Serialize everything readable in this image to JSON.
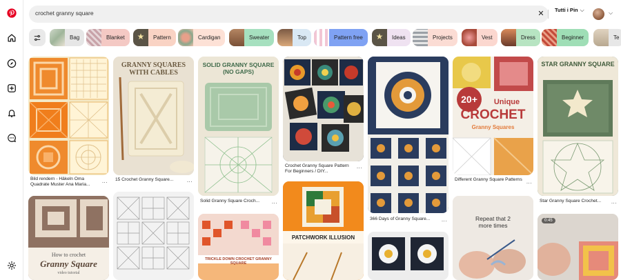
{
  "search": {
    "query": "crochet granny square",
    "clear_icon": "close-icon"
  },
  "scope": {
    "label": "Tutti i Pin"
  },
  "rail": {
    "icons": [
      "pinterest-logo",
      "home-icon",
      "compass-icon",
      "create-icon",
      "bell-icon",
      "messages-icon",
      "settings-icon"
    ]
  },
  "colors": {
    "brand": "#e60023",
    "chip_selected": "#7fa2f3"
  },
  "chips": [
    {
      "label": "Bag",
      "bg": "#e6e6e6"
    },
    {
      "label": "Blanket",
      "bg": "#f4c9c4"
    },
    {
      "label": "Pattern",
      "bg": "#f9d3c4"
    },
    {
      "label": "Cardigan",
      "bg": "#fde1d6"
    },
    {
      "label": "Sweater",
      "bg": "#a6e0bf"
    },
    {
      "label": "Top",
      "bg": "#d9e8f4"
    },
    {
      "label": "Pattern free",
      "bg": "#7fa2f3"
    },
    {
      "label": "Ideas",
      "bg": "#efe2f1"
    },
    {
      "label": "Projects",
      "bg": "#fbdcd4"
    },
    {
      "label": "Vest",
      "bg": "#fbd7cf"
    },
    {
      "label": "Dress",
      "bg": "#b7e4c2"
    },
    {
      "label": "Beginner",
      "bg": "#9fdeb6"
    },
    {
      "label": "Te",
      "bg": "#e7e7e7"
    }
  ],
  "pins": [
    {
      "caption": "Bild rendern - Häkeln Oma Quadrate Muster Ana Maria..."
    },
    {
      "caption": "",
      "overlay": "How to crochet",
      "overlay2": "Granny Square",
      "overlay3": "video tutorial"
    },
    {
      "caption": "15 Crochet Granny Square...",
      "overlay": "GRANNY SQUARES WITH CABLES"
    },
    {
      "caption": ""
    },
    {
      "caption": "Solid Granny Square Croch...",
      "overlay": "SOLID GRANNY SQUARE (NO GAPS)"
    },
    {
      "caption": "",
      "overlay": "TRICKLE DOWN CROCHET GRANNY SQUARE"
    },
    {
      "caption": "Crochet Granny Square Pattern For Beginners / DIY..."
    },
    {
      "caption": "",
      "overlay": "PATCHWORK ILLUSION"
    },
    {
      "caption": "366 Days of Granny Square..."
    },
    {
      "caption": ""
    },
    {
      "caption": "Different Granny Square Patterns",
      "overlay": "20+",
      "overlay2": "Unique",
      "overlay3": "CROCHET",
      "overlay4": "Granny Squares"
    },
    {
      "caption": "",
      "overlay": "Repeat that 2 more times"
    },
    {
      "caption": "Star Granny Square Crochet...",
      "overlay": "STAR GRANNY SQUARE"
    },
    {
      "caption": "",
      "badge": "0:45"
    }
  ]
}
